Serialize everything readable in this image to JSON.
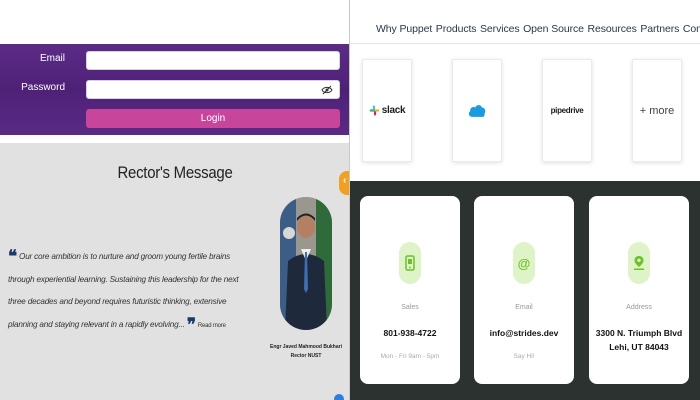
{
  "login": {
    "email_label": "Email",
    "password_label": "Password",
    "email_value": "",
    "password_value": "",
    "login_button": "Login"
  },
  "rector": {
    "title": "Rector's Message",
    "quote": "Our core ambition is to nurture and groom young fertile brains through experiential learning. Sustaining this leadership for the next three decades and beyond requires futuristic thinking, extensive planning and staying relevant in a rapidly evolving...",
    "read_more": "Read more",
    "name": "Engr Javed Mahmood Bukhari",
    "designation": "Rector NUST"
  },
  "nav": {
    "links": [
      "Why Puppet",
      "Products",
      "Services",
      "Open Source",
      "Resources",
      "Partners",
      "Company"
    ]
  },
  "integrations": {
    "slack": "slack",
    "salesforce_icon": "salesforce-cloud-icon",
    "pipedrive": "pipedrive",
    "more": "+ more"
  },
  "contact": {
    "sales": {
      "title": "Sales",
      "value": "801-938-4722",
      "sub": "Mon - Fri 9am - 5pm",
      "icon": "phone-icon"
    },
    "email": {
      "title": "Email",
      "value": "info@strides.dev",
      "sub": "Say Hi!",
      "icon": "at-sign-icon"
    },
    "address": {
      "title": "Address",
      "line1": "3300 N. Triumph Blvd",
      "line2": "Lehi, UT 84043",
      "icon": "map-pin-icon"
    }
  },
  "colors": {
    "login_bg": "#52237d",
    "login_button": "#c7469c",
    "rector_bg": "#e2e1e1",
    "toggle_tab": "#f0a023",
    "contact_bg": "#2c3230",
    "icon_circle": "#dff3c8",
    "icon_green": "#6fbf2a"
  }
}
